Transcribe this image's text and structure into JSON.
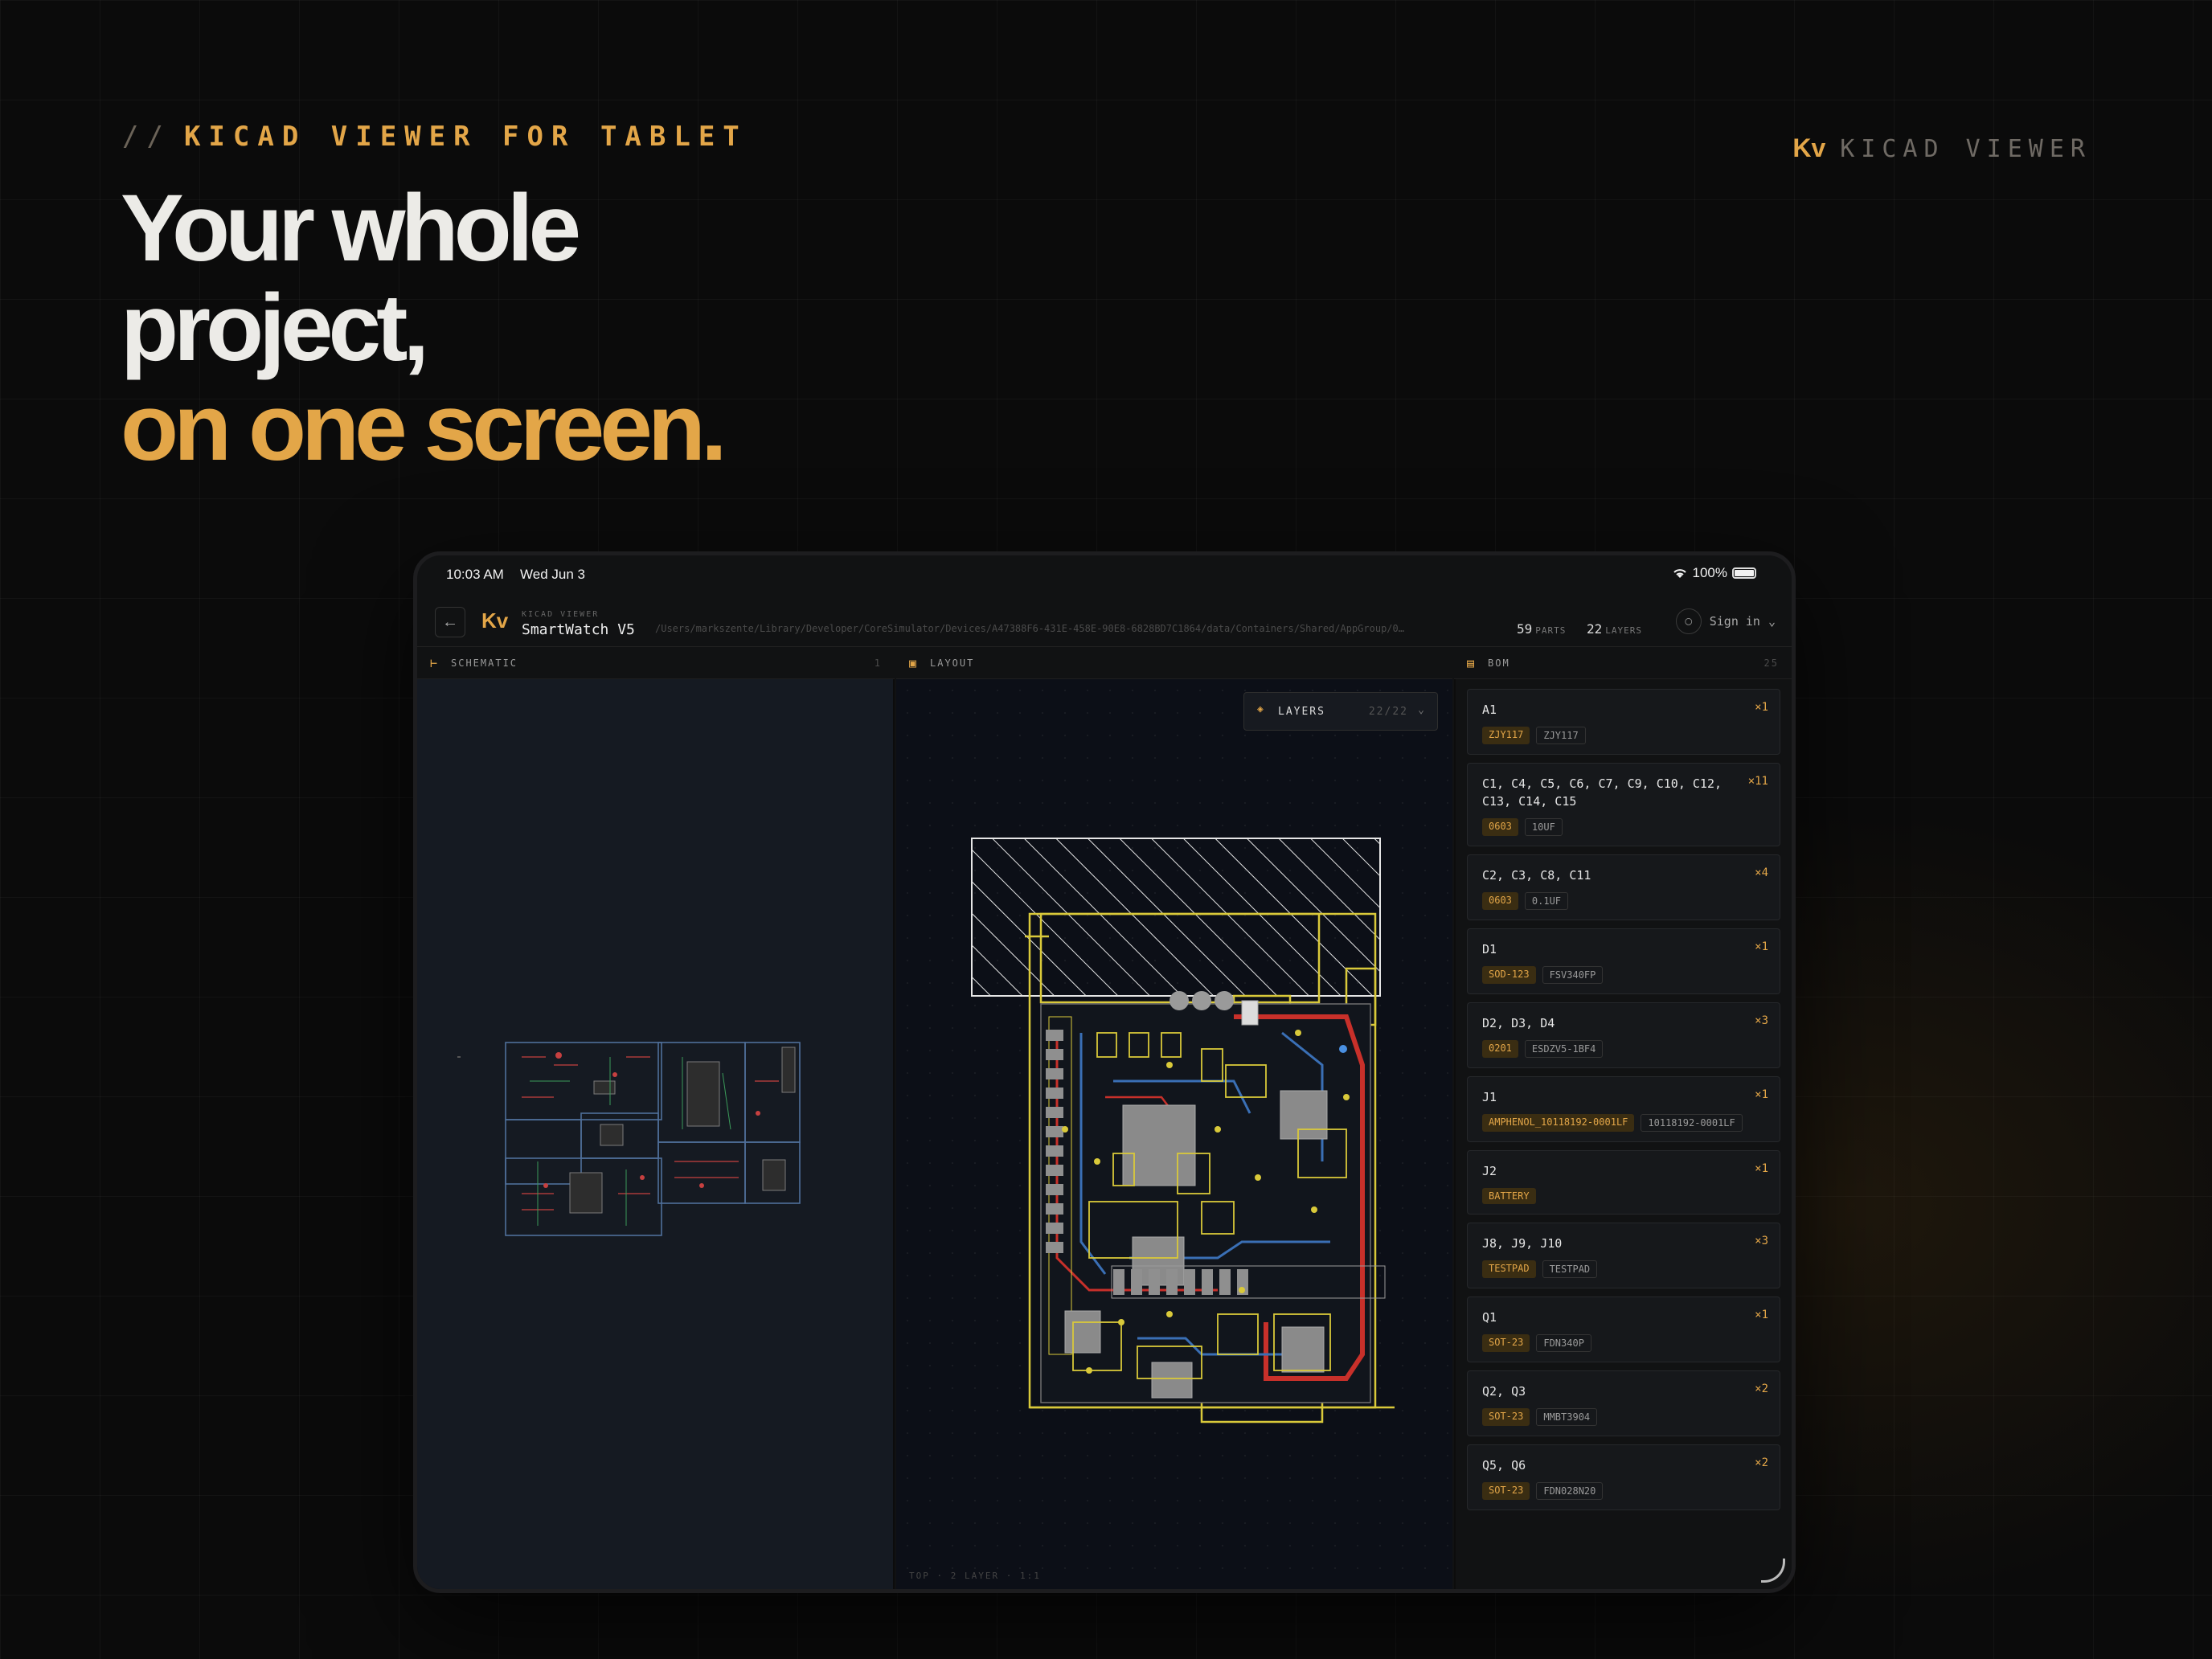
{
  "hero": {
    "eyebrow_slashes": "//",
    "eyebrow": "KICAD VIEWER FOR TABLET",
    "brand_logo": "Kv",
    "brand_name": "KICAD VIEWER",
    "headline_line1": "Your whole",
    "headline_line2": "project,",
    "headline_line3": "on one screen."
  },
  "status": {
    "time": "10:03 AM",
    "date": "Wed Jun 3",
    "battery": "100%",
    "wifi_icon": "wifi-icon"
  },
  "toolbar": {
    "back_icon": "←",
    "logo": "Kv",
    "app_label": "KICAD VIEWER",
    "project_name": "SmartWatch V5",
    "path": "/Users/markszente/Library/Developer/CoreSimulator/Devices/A47388F6-431E-458E-90E8-6828BD7C1864/data/Containers/Shared/AppGroup/0…",
    "parts_count": "59",
    "parts_label": "PARTS",
    "layers_count": "22",
    "layers_label": "LAYERS",
    "signin_label": "Sign in",
    "chevron": "⌄"
  },
  "panes": {
    "schematic": {
      "title": "SCHEMATIC",
      "count": "1"
    },
    "layout": {
      "title": "LAYOUT",
      "layers_button": "LAYERS",
      "layers_count": "22/22",
      "footer": "TOP · 2 LAYER · 1:1"
    },
    "bom": {
      "title": "BOM",
      "count": "25"
    }
  },
  "bom_items": [
    {
      "ref": "A1",
      "qty": "×1",
      "pkg": "ZJY117",
      "val": "ZJY117"
    },
    {
      "ref": "C1, C4, C5, C6, C7, C9, C10, C12, C13, C14, C15",
      "qty": "×11",
      "pkg": "0603",
      "val": "10UF"
    },
    {
      "ref": "C2, C3, C8, C11",
      "qty": "×4",
      "pkg": "0603",
      "val": "0.1UF"
    },
    {
      "ref": "D1",
      "qty": "×1",
      "pkg": "SOD-123",
      "val": "FSV340FP"
    },
    {
      "ref": "D2, D3, D4",
      "qty": "×3",
      "pkg": "0201",
      "val": "ESDZV5-1BF4"
    },
    {
      "ref": "J1",
      "qty": "×1",
      "pkg": "AMPHENOL_10118192-0001LF",
      "val": "10118192-0001LF"
    },
    {
      "ref": "J2",
      "qty": "×1",
      "pkg": "BATTERY",
      "val": ""
    },
    {
      "ref": "J8, J9, J10",
      "qty": "×3",
      "pkg": "TESTPAD",
      "val": "TESTPAD"
    },
    {
      "ref": "Q1",
      "qty": "×1",
      "pkg": "SOT-23",
      "val": "FDN340P"
    },
    {
      "ref": "Q2, Q3",
      "qty": "×2",
      "pkg": "SOT-23",
      "val": "MMBT3904"
    },
    {
      "ref": "Q5, Q6",
      "qty": "×2",
      "pkg": "SOT-23",
      "val": "FDN028N20"
    }
  ],
  "colors": {
    "accent": "#e3a648",
    "background": "#0b0b0b",
    "pcb_yellow": "#d9c93a",
    "pcb_red": "#c8302a",
    "pcb_blue": "#3a6fb5"
  }
}
